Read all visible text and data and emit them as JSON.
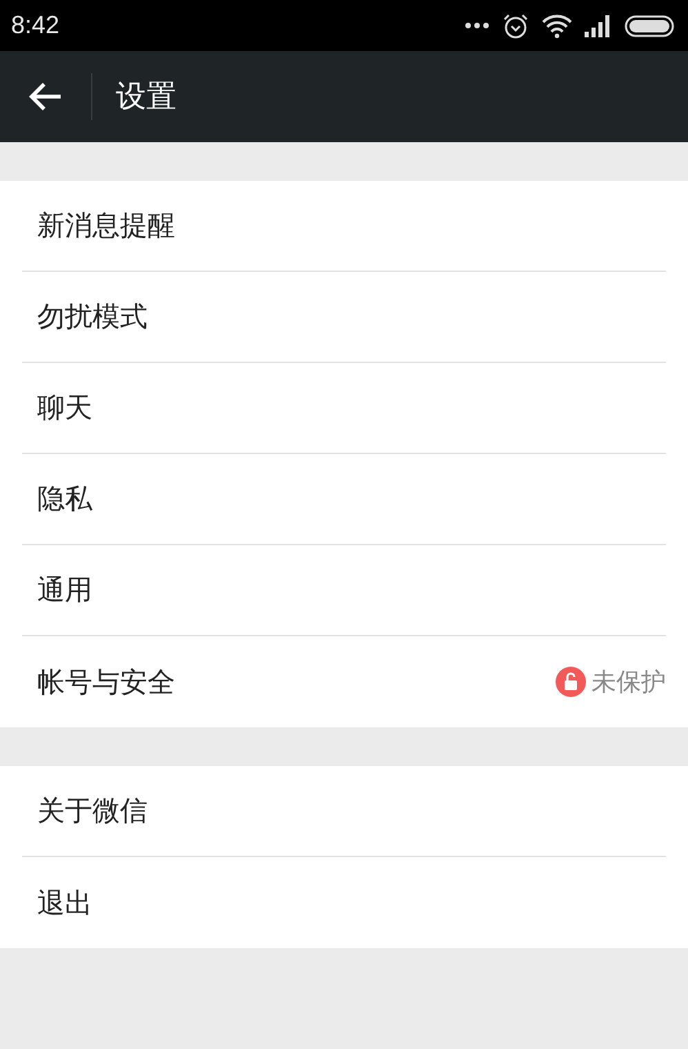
{
  "status_bar": {
    "time": "8:42"
  },
  "header": {
    "title": "设置"
  },
  "sections": [
    {
      "items": [
        {
          "label": "新消息提醒"
        },
        {
          "label": "勿扰模式"
        },
        {
          "label": "聊天"
        },
        {
          "label": "隐私"
        },
        {
          "label": "通用"
        },
        {
          "label": "帐号与安全",
          "status": "未保护"
        }
      ]
    },
    {
      "items": [
        {
          "label": "关于微信"
        },
        {
          "label": "退出"
        }
      ]
    }
  ]
}
